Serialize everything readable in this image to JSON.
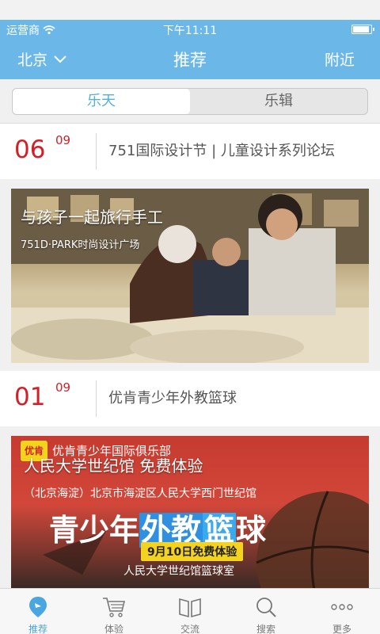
{
  "status": {
    "carrier": "运营商",
    "time": "下午11:11"
  },
  "nav": {
    "city": "北京",
    "title": "推荐",
    "right": "附近"
  },
  "segments": {
    "left": "乐天",
    "right": "乐辑"
  },
  "events": [
    {
      "day": "06",
      "month": "09",
      "title": "751国际设计节 | 儿童设计系列论坛",
      "image_title": "与孩子一起旅行手工",
      "image_subtitle": "751D·PARK时尚设计广场"
    },
    {
      "day": "01",
      "month": "09",
      "title": "优肯青少年外教篮球",
      "poster": {
        "logo": "优肯",
        "club": "优肯青少年国际俱乐部",
        "headline": "人民大学世纪馆 免费体验",
        "address": "（北京海淀）北京市海淀区人民大学西门世纪馆",
        "big_pre": "青少年",
        "big_hl1": "外教",
        "big_hl2": "篮",
        "big_post": "球",
        "badge": "9月10日免费体验",
        "venue": "人民大学世纪馆篮球室"
      }
    }
  ],
  "tabs": [
    {
      "label": "推荐",
      "icon": "location-pin-icon",
      "active": true
    },
    {
      "label": "体验",
      "icon": "shopping-cart-icon",
      "active": false
    },
    {
      "label": "交流",
      "icon": "open-book-icon",
      "active": false
    },
    {
      "label": "搜索",
      "icon": "search-icon",
      "active": false
    },
    {
      "label": "更多",
      "icon": "more-icon",
      "active": false
    }
  ],
  "colors": {
    "accent": "#6bb8e8",
    "date_red": "#d0202a",
    "tab_active": "#4aa6e0"
  }
}
